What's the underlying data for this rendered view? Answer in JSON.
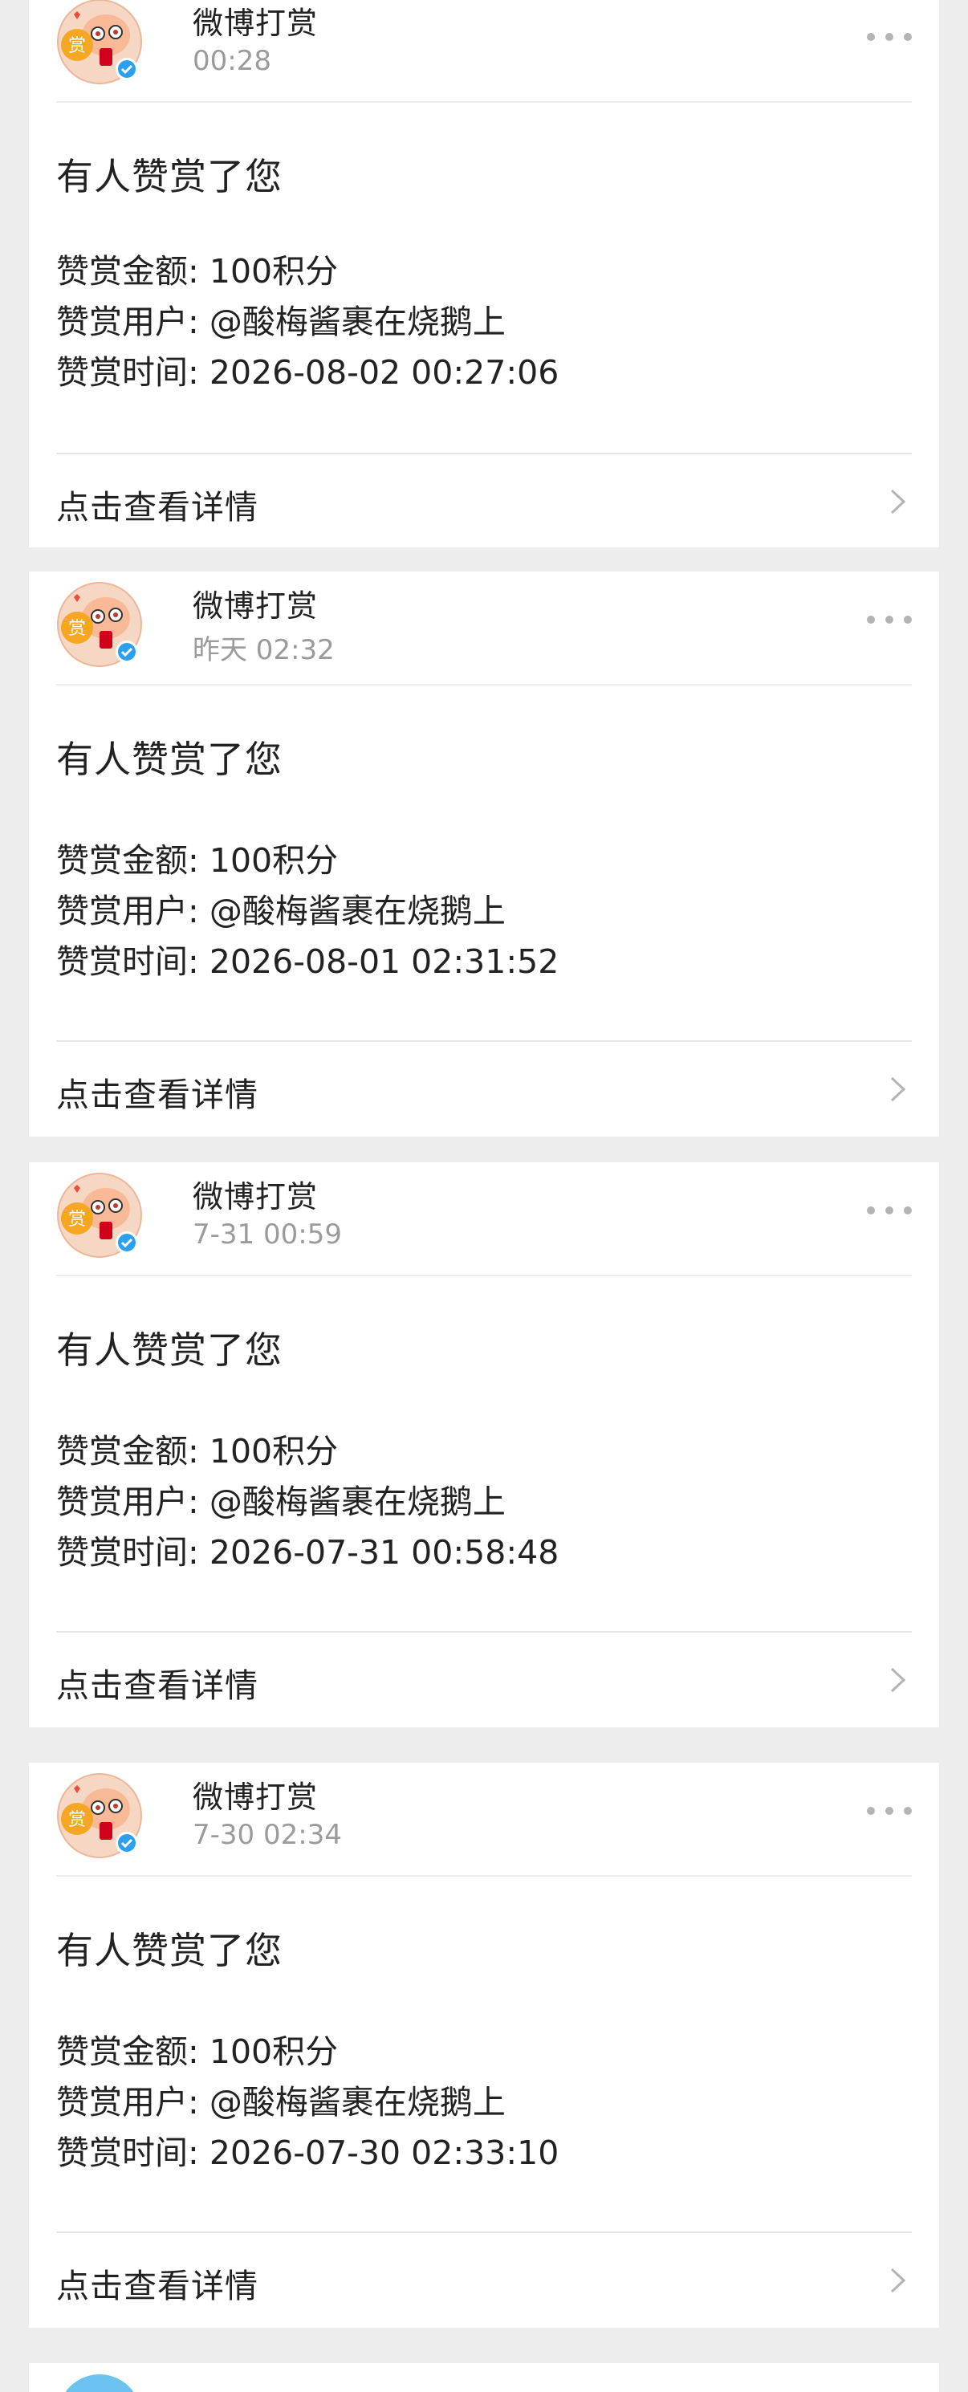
{
  "notifications": [
    {
      "sender": "微博打赏",
      "time": "00:28",
      "title": "有人赞赏了您",
      "amount_label": "赞赏金额: ",
      "amount": "100积分",
      "user_label": "赞赏用户: ",
      "user": "@酸梅酱裹在烧鹅上",
      "datetime_label": "赞赏时间: ",
      "datetime": "2026-08-02 00:27:06",
      "detail_label": "点击查看详情"
    },
    {
      "sender": "微博打赏",
      "time": "昨天 02:32",
      "title": "有人赞赏了您",
      "amount_label": "赞赏金额: ",
      "amount": "100积分",
      "user_label": "赞赏用户: ",
      "user": "@酸梅酱裹在烧鹅上",
      "datetime_label": "赞赏时间: ",
      "datetime": "2026-08-01 02:31:52",
      "detail_label": "点击查看详情"
    },
    {
      "sender": "微博打赏",
      "time": "7-31 00:59",
      "title": "有人赞赏了您",
      "amount_label": "赞赏金额: ",
      "amount": "100积分",
      "user_label": "赞赏用户: ",
      "user": "@酸梅酱裹在烧鹅上",
      "datetime_label": "赞赏时间: ",
      "datetime": "2026-07-31 00:58:48",
      "detail_label": "点击查看详情"
    },
    {
      "sender": "微博打赏",
      "time": "7-30 02:34",
      "title": "有人赞赏了您",
      "amount_label": "赞赏金额: ",
      "amount": "100积分",
      "user_label": "赞赏用户: ",
      "user": "@酸梅酱裹在烧鹅上",
      "datetime_label": "赞赏时间: ",
      "datetime": "2026-07-30 02:33:10",
      "detail_label": "点击查看详情"
    }
  ],
  "avatar": {
    "badge_char": "赏",
    "icon": "reward-avatar-icon",
    "verified_icon": "verified-badge-icon"
  },
  "colors": {
    "background": "#ededed",
    "card": "#ffffff",
    "text": "#222222",
    "secondary_text": "#9b9b9b",
    "verified_blue": "#2ba0f0",
    "badge_orange": "#f5a623"
  }
}
